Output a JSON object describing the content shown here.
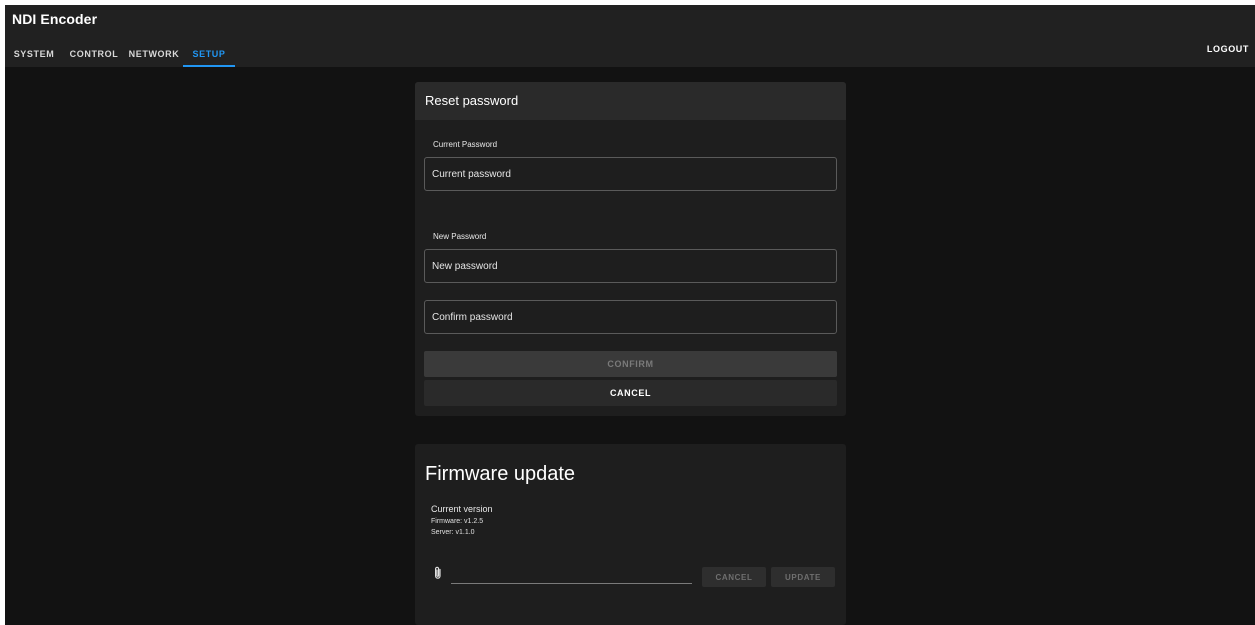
{
  "app": {
    "title": "NDI Encoder"
  },
  "nav": {
    "tabs": [
      {
        "label": "SYSTEM"
      },
      {
        "label": "CONTROL"
      },
      {
        "label": "NETWORK"
      },
      {
        "label": "SETUP",
        "active": true
      }
    ],
    "logout_label": "LOGOUT",
    "active_color": "#2196f3"
  },
  "reset_password": {
    "title": "Reset password",
    "current_label": "Current Password",
    "current_placeholder": "Current password",
    "new_label": "New Password",
    "new_placeholder": "New password",
    "confirm_placeholder": "Confirm password",
    "confirm_button": "CONFIRM",
    "cancel_button": "CANCEL"
  },
  "firmware": {
    "title": "Firmware update",
    "current_version_label": "Current version",
    "firmware_line": "Firmware: v1.2.5",
    "server_line": "Server: v1.1.0",
    "attach_icon": "paperclip-icon",
    "cancel_button": "CANCEL",
    "update_button": "UPDATE"
  }
}
